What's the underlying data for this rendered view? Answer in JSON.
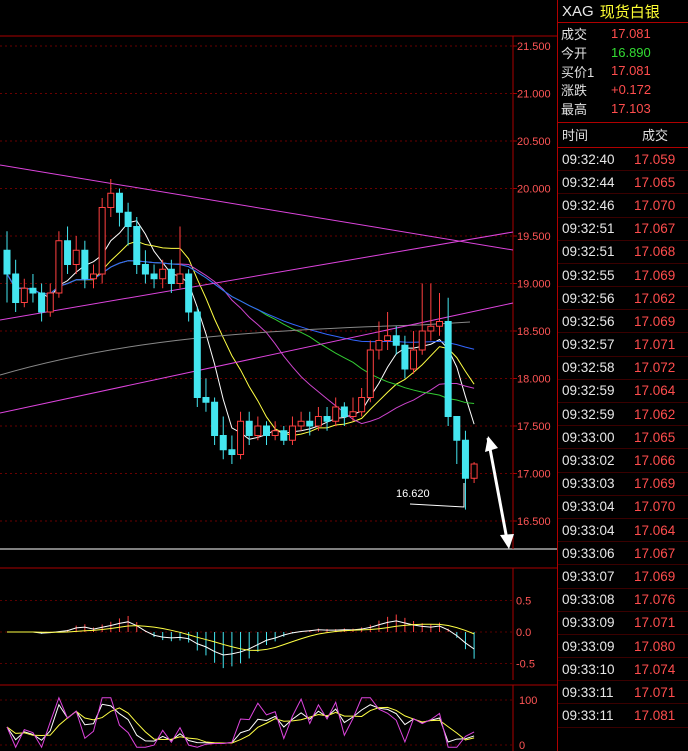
{
  "header": {
    "code": "XAG",
    "name": "现货白银"
  },
  "quote": {
    "last_label": "成交",
    "last_value": "17.081",
    "open_label": "今开",
    "open_value": "16.890",
    "bid_label": "买价1",
    "bid_value": "17.081",
    "change_label": "涨跌",
    "change_value": "+0.172",
    "high_label": "最高",
    "high_value": "17.103"
  },
  "ticks_header": {
    "time": "时间",
    "price": "成交"
  },
  "ticks": [
    {
      "time": "09:32:40",
      "price": "17.059"
    },
    {
      "time": "09:32:44",
      "price": "17.065"
    },
    {
      "time": "09:32:46",
      "price": "17.070"
    },
    {
      "time": "09:32:51",
      "price": "17.067"
    },
    {
      "time": "09:32:51",
      "price": "17.068"
    },
    {
      "time": "09:32:55",
      "price": "17.069"
    },
    {
      "time": "09:32:56",
      "price": "17.062"
    },
    {
      "time": "09:32:56",
      "price": "17.069"
    },
    {
      "time": "09:32:57",
      "price": "17.071"
    },
    {
      "time": "09:32:58",
      "price": "17.072"
    },
    {
      "time": "09:32:59",
      "price": "17.064"
    },
    {
      "time": "09:32:59",
      "price": "17.062"
    },
    {
      "time": "09:33:00",
      "price": "17.065"
    },
    {
      "time": "09:33:02",
      "price": "17.066"
    },
    {
      "time": "09:33:03",
      "price": "17.069"
    },
    {
      "time": "09:33:04",
      "price": "17.070"
    },
    {
      "time": "09:33:04",
      "price": "17.064"
    },
    {
      "time": "09:33:06",
      "price": "17.067"
    },
    {
      "time": "09:33:07",
      "price": "17.069"
    },
    {
      "time": "09:33:08",
      "price": "17.076"
    },
    {
      "time": "09:33:09",
      "price": "17.071"
    },
    {
      "time": "09:33:09",
      "price": "17.080"
    },
    {
      "time": "09:33:10",
      "price": "17.074"
    },
    {
      "time": "09:33:11",
      "price": "17.071"
    },
    {
      "time": "09:33:11",
      "price": "17.081"
    }
  ],
  "chart_data": {
    "type": "candlestick",
    "y_axis_ticks": [
      "21.500",
      "21.000",
      "20.500",
      "20.000",
      "19.500",
      "19.000",
      "18.500",
      "18.000",
      "17.500",
      "17.000",
      "16.500"
    ],
    "ylim": [
      16.25,
      21.6
    ],
    "low_annotation": "16.620",
    "macd_ticks": [
      "0.5",
      "0.0",
      "-0.5"
    ],
    "kdj_ticks": [
      "100",
      "0"
    ],
    "candles": [
      [
        19.35,
        19.1,
        19.55,
        18.8
      ],
      [
        19.1,
        18.8,
        19.25,
        18.7
      ],
      [
        18.8,
        18.95,
        19.05,
        18.75
      ],
      [
        18.95,
        18.9,
        19.1,
        18.8
      ],
      [
        18.9,
        18.7,
        19.0,
        18.6
      ],
      [
        18.7,
        18.9,
        19.0,
        18.65
      ],
      [
        18.9,
        19.45,
        19.55,
        18.85
      ],
      [
        19.45,
        19.2,
        19.6,
        19.1
      ],
      [
        19.2,
        19.35,
        19.5,
        19.1
      ],
      [
        19.35,
        19.05,
        19.45,
        18.95
      ],
      [
        19.05,
        19.1,
        19.2,
        18.95
      ],
      [
        19.1,
        19.8,
        19.9,
        19.0
      ],
      [
        19.8,
        19.95,
        20.1,
        19.7
      ],
      [
        19.95,
        19.75,
        20.0,
        19.6
      ],
      [
        19.75,
        19.6,
        19.85,
        19.4
      ],
      [
        19.6,
        19.2,
        19.7,
        19.1
      ],
      [
        19.2,
        19.1,
        19.35,
        19.0
      ],
      [
        19.1,
        19.05,
        19.2,
        18.95
      ],
      [
        19.05,
        19.15,
        19.25,
        18.95
      ],
      [
        19.15,
        19.0,
        19.25,
        18.9
      ],
      [
        19.0,
        19.1,
        19.6,
        18.95
      ],
      [
        19.1,
        18.7,
        19.15,
        18.6
      ],
      [
        18.7,
        17.8,
        18.75,
        17.7
      ],
      [
        17.8,
        17.75,
        18.0,
        17.65
      ],
      [
        17.75,
        17.4,
        17.8,
        17.3
      ],
      [
        17.4,
        17.25,
        17.6,
        17.15
      ],
      [
        17.25,
        17.2,
        17.4,
        17.1
      ],
      [
        17.2,
        17.55,
        17.65,
        17.15
      ],
      [
        17.55,
        17.4,
        17.65,
        17.3
      ],
      [
        17.4,
        17.5,
        17.6,
        17.35
      ],
      [
        17.5,
        17.4,
        17.55,
        17.3
      ],
      [
        17.4,
        17.45,
        17.55,
        17.35
      ],
      [
        17.45,
        17.35,
        17.5,
        17.3
      ],
      [
        17.35,
        17.5,
        17.6,
        17.3
      ],
      [
        17.5,
        17.55,
        17.65,
        17.45
      ],
      [
        17.55,
        17.5,
        17.65,
        17.4
      ],
      [
        17.5,
        17.6,
        17.7,
        17.45
      ],
      [
        17.6,
        17.55,
        17.7,
        17.45
      ],
      [
        17.55,
        17.7,
        17.8,
        17.5
      ],
      [
        17.7,
        17.6,
        17.75,
        17.5
      ],
      [
        17.6,
        17.65,
        17.8,
        17.55
      ],
      [
        17.65,
        17.8,
        17.9,
        17.6
      ],
      [
        17.8,
        18.3,
        18.4,
        17.75
      ],
      [
        18.3,
        18.4,
        18.6,
        18.2
      ],
      [
        18.4,
        18.45,
        18.7,
        18.3
      ],
      [
        18.45,
        18.35,
        18.55,
        18.25
      ],
      [
        18.35,
        18.1,
        18.45,
        18.0
      ],
      [
        18.1,
        18.3,
        18.5,
        18.05
      ],
      [
        18.3,
        18.5,
        19.0,
        18.25
      ],
      [
        18.5,
        18.55,
        19.0,
        18.4
      ],
      [
        18.55,
        18.6,
        18.9,
        18.45
      ],
      [
        18.6,
        17.6,
        18.85,
        17.5
      ],
      [
        17.6,
        17.35,
        17.55,
        17.1
      ],
      [
        17.35,
        16.95,
        17.45,
        16.62
      ],
      [
        16.95,
        17.1,
        17.12,
        16.9
      ]
    ]
  }
}
